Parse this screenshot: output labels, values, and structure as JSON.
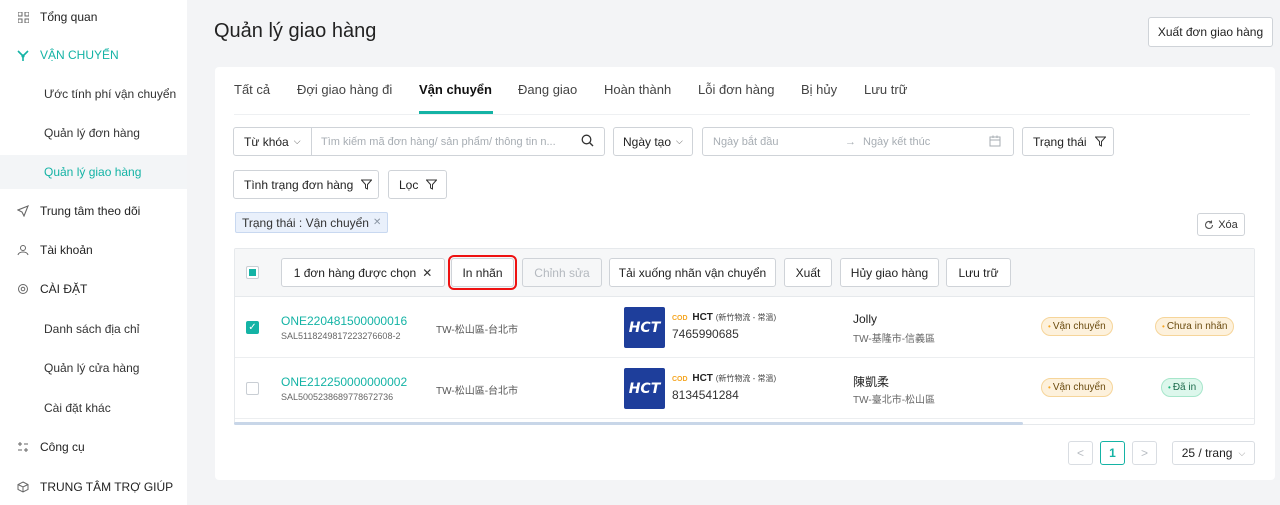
{
  "sidebar": {
    "items": [
      {
        "label": "Tổng quan",
        "icon": "grid-icon"
      },
      {
        "label": "VẬN CHUYỂN",
        "icon": "truck-icon"
      },
      {
        "label": "Ước tính phí vận chuyển"
      },
      {
        "label": "Quản lý đơn hàng"
      },
      {
        "label": "Quản lý giao hàng"
      },
      {
        "label": "Trung tâm theo dõi",
        "icon": "send-icon"
      },
      {
        "label": "Tài khoản",
        "icon": "user-icon"
      },
      {
        "label": "CÀI ĐẶT",
        "icon": "settings-icon"
      },
      {
        "label": "Danh sách địa chỉ"
      },
      {
        "label": "Quản lý cửa hàng"
      },
      {
        "label": "Cài đặt khác"
      },
      {
        "label": "Công cụ",
        "icon": "tools-icon"
      },
      {
        "label": "TRUNG TÂM TRỢ GIÚP",
        "icon": "help-icon"
      }
    ]
  },
  "header": {
    "title": "Quản lý giao hàng",
    "export_label": "Xuất đơn giao hàng"
  },
  "tabs": [
    "Tất cả",
    "Đợi giao hàng đi",
    "Vận chuyển",
    "Đang giao",
    "Hoàn thành",
    "Lỗi đơn hàng",
    "Bị hủy",
    "Lưu trữ"
  ],
  "filters": {
    "keyword_label": "Từ khóa",
    "search_placeholder": "Tìm kiếm mã đơn hàng/ sản phẩm/ thông tin n...",
    "date_label": "Ngày tạo",
    "start_placeholder": "Ngày bắt đầu",
    "range_arrow": "→",
    "end_placeholder": "Ngày kết thúc",
    "status_label": "Trạng thái",
    "order_status_label": "Tình trạng đơn hàng",
    "filter_label": "Lọc",
    "active_tag": "Trạng thái : Vận chuyển",
    "clear_label": "Xóa"
  },
  "bulk": {
    "selected_label": "1 đơn hàng được chọn",
    "print_label": "In nhãn",
    "edit_label": "Chỉnh sửa",
    "download_label": "Tải xuống nhãn vận chuyển",
    "export_label": "Xuất",
    "cancel_label": "Hủy giao hàng",
    "archive_label": "Lưu trữ"
  },
  "rows": [
    {
      "order_id": "ONE220481500000016",
      "sal": "SAL5118249817223276608-2",
      "sender_addr": "TW-松山區-台北市",
      "carrier_cod": "COD",
      "carrier_name": "HCT",
      "carrier_sub": "(新竹物流 - 常溫)",
      "logo_text": "HCT",
      "tracking": "7465990685",
      "receiver": "Jolly",
      "receiver_addr": "TW-基隆市-信義區",
      "status": "Vận chuyển",
      "label_status": "Chưa in nhãn",
      "checked": true
    },
    {
      "order_id": "ONE212250000000002",
      "sal": "SAL5005238689778672736",
      "sender_addr": "TW-松山區-台北市",
      "carrier_cod": "COD",
      "carrier_name": "HCT",
      "carrier_sub": "(新竹物流 - 常溫)",
      "logo_text": "HCT",
      "tracking": "8134541284",
      "receiver": "陳凱柔",
      "receiver_addr": "TW-臺北市-松山區",
      "status": "Vận chuyển",
      "label_status": "Đã in",
      "checked": false
    }
  ],
  "pagination": {
    "prev": "<",
    "current": "1",
    "next": ">",
    "page_size": "25 / trang"
  },
  "colors": {
    "accent": "#14b3a5",
    "highlight": "#ee1111"
  }
}
